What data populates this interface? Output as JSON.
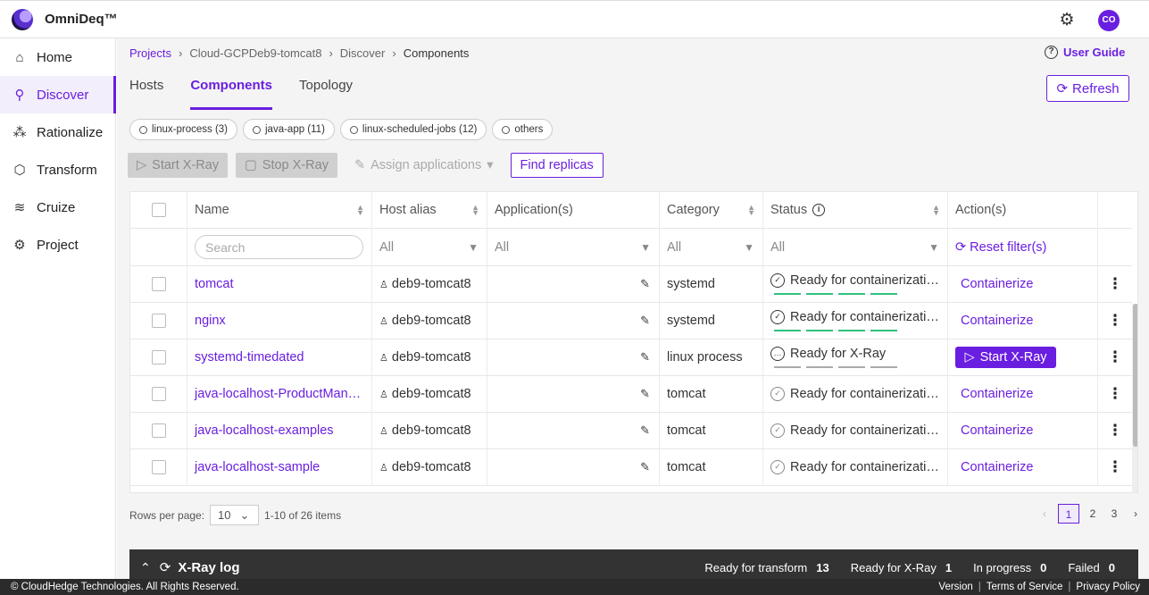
{
  "app": {
    "brand": "OmniDeq™",
    "avatar_initials": "CO"
  },
  "sidebar": {
    "items": [
      {
        "label": "Home",
        "icon": "home-icon"
      },
      {
        "label": "Discover",
        "icon": "discover-icon",
        "active": true
      },
      {
        "label": "Rationalize",
        "icon": "rationalize-icon"
      },
      {
        "label": "Transform",
        "icon": "transform-icon"
      },
      {
        "label": "Cruize",
        "icon": "cruize-icon"
      },
      {
        "label": "Project",
        "icon": "project-gear-icon"
      }
    ]
  },
  "breadcrumb": [
    "Projects",
    "Cloud-GCPDeb9-tomcat8",
    "Discover",
    "Components"
  ],
  "user_guide": "User Guide",
  "tabs": [
    "Hosts",
    "Components",
    "Topology"
  ],
  "refresh_label": "Refresh",
  "chips": [
    "linux-process (3)",
    "java-app (11)",
    "linux-scheduled-jobs (12)",
    "others"
  ],
  "toolbar": {
    "start_xray": "Start X-Ray",
    "stop_xray": "Stop X-Ray",
    "assign_applications": "Assign applications",
    "find_replicas": "Find replicas"
  },
  "table": {
    "headers": [
      "Name",
      "Host alias",
      "Application(s)",
      "Category",
      "Status",
      "Action(s)"
    ],
    "filters": {
      "search_placeholder": "Search",
      "all": "All",
      "reset": "Reset filter(s)"
    },
    "rows": [
      {
        "name": "tomcat",
        "host": "deb9-tomcat8",
        "category": "systemd",
        "status": "Ready for containerizati…",
        "action": "Containerize"
      },
      {
        "name": "nginx",
        "host": "deb9-tomcat8",
        "category": "systemd",
        "status": "Ready for containerizati…",
        "action": "Containerize"
      },
      {
        "name": "systemd-timedated",
        "host": "deb9-tomcat8",
        "category": "linux process",
        "status": "Ready for X-Ray",
        "action": "Start X-Ray"
      },
      {
        "name": "java-localhost-ProductMan…",
        "host": "deb9-tomcat8",
        "category": "tomcat",
        "status": "Ready for containerizati…",
        "action": "Containerize"
      },
      {
        "name": "java-localhost-examples",
        "host": "deb9-tomcat8",
        "category": "tomcat",
        "status": "Ready for containerizati…",
        "action": "Containerize"
      },
      {
        "name": "java-localhost-sample",
        "host": "deb9-tomcat8",
        "category": "tomcat",
        "status": "Ready for containerizati…",
        "action": "Containerize"
      }
    ]
  },
  "pagination": {
    "rows_per_page_label": "Rows per page:",
    "rows_per_page": "10",
    "range": "1-10 of 26 items",
    "pages": [
      "1",
      "2",
      "3"
    ]
  },
  "xray_log": {
    "title": "X-Ray log",
    "stats": [
      {
        "label": "Ready for transform",
        "value": "13"
      },
      {
        "label": "Ready for X-Ray",
        "value": "1"
      },
      {
        "label": "In progress",
        "value": "0"
      },
      {
        "label": "Failed",
        "value": "0"
      }
    ]
  },
  "footer": {
    "copyright": "© CloudHedge Technologies. All Rights Reserved.",
    "links": [
      "Version",
      "Terms of Service",
      "Privacy Policy"
    ]
  },
  "colors": {
    "accent": "#6a1ee0",
    "success": "#2ec27e"
  }
}
